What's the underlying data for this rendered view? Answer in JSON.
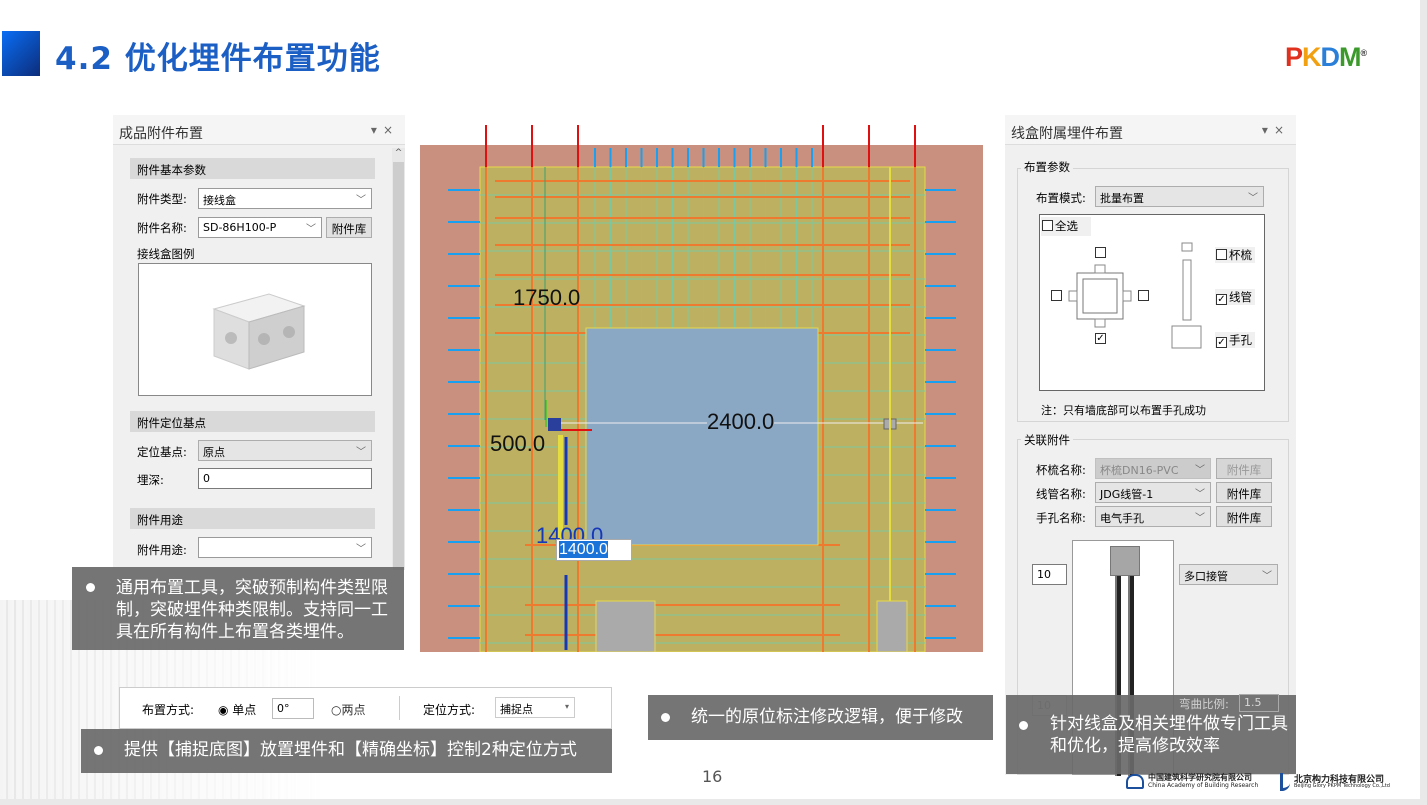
{
  "slide": {
    "title": "4.2 优化埋件布置功能",
    "logo": "PKPM",
    "page_number": "16",
    "footer_logos": [
      {
        "cn": "中国建筑科学研究院有限公司",
        "en": "China Academy of Building Research"
      },
      {
        "cn": "北京构力科技有限公司",
        "en": "Beijing Glory PKPM Technology Co.,Ltd"
      }
    ]
  },
  "left_panel": {
    "title": "成品附件布置",
    "sections": {
      "basic": "附件基本参数",
      "position": "附件定位基点",
      "usage": "附件用途"
    },
    "type_label": "附件类型:",
    "type_value": "接线盒",
    "name_label": "附件名称:",
    "name_value": "SD-86H100-P",
    "library_button": "附件库",
    "preview_label": "接线盒图例",
    "base_point_label": "定位基点:",
    "base_point_value": "原点",
    "depth_label": "埋深:",
    "depth_value": "0",
    "usage_label": "附件用途:",
    "usage_value": ""
  },
  "toolbar": {
    "layout_label": "布置方式:",
    "single_point": "单点",
    "angle_value": "0°",
    "two_point": "两点",
    "locate_label": "定位方式:",
    "locate_value": "捕捉点",
    "single_selected": true
  },
  "cad": {
    "dim_vertical": "1750.0",
    "dim_horizontal": "2400.0",
    "dim_left": "500.0",
    "dim_bottom": "1400.0",
    "edit_value": "1400.0"
  },
  "right_panel": {
    "title": "线盒附属埋件布置",
    "group_layout": "布置参数",
    "mode_label": "布置模式:",
    "mode_value": "批量布置",
    "select_all": "全选",
    "select_all_checked": false,
    "side_checks": [
      {
        "pos": "top",
        "checked": false
      },
      {
        "pos": "left",
        "checked": false
      },
      {
        "pos": "right",
        "checked": false
      },
      {
        "pos": "bottom",
        "checked": true
      }
    ],
    "options": [
      {
        "label": "杯梳",
        "checked": false
      },
      {
        "label": "线管",
        "checked": true
      },
      {
        "label": "手孔",
        "checked": true
      }
    ],
    "note": "注：只有墙底部可以布置手孔成功",
    "group_related": "关联附件",
    "comb_label": "杯梳名称:",
    "comb_value": "杯梳DN16-PVC",
    "pipe_label": "线管名称:",
    "pipe_value": "JDG线管-1",
    "hole_label": "手孔名称:",
    "hole_value": "电气手孔",
    "library_button": "附件库",
    "offset_value": "10",
    "pipe_mode_value": "多口接管",
    "bottom_value": "10",
    "bend_label": "弯曲比例:",
    "bend_value": "1.5"
  },
  "callouts": {
    "left": "通用布置工具，突破预制构件类型限制，突破埋件种类限制。支持同一工具在所有构件上布置各类埋件。",
    "bottom_left": "提供【捕捉底图】放置埋件和【精确坐标】控制2种定位方式",
    "center": "统一的原位标注修改逻辑，便于修改",
    "right": "针对线盒及相关埋件做专门工具和优化，提高修改效率"
  },
  "colors": {
    "title_blue": "#1b5ec4",
    "callout_bg": "#696969",
    "cad_wall": "#c98f7f",
    "cad_panel": "#bdb060",
    "cad_window": "#8aa7c4"
  }
}
